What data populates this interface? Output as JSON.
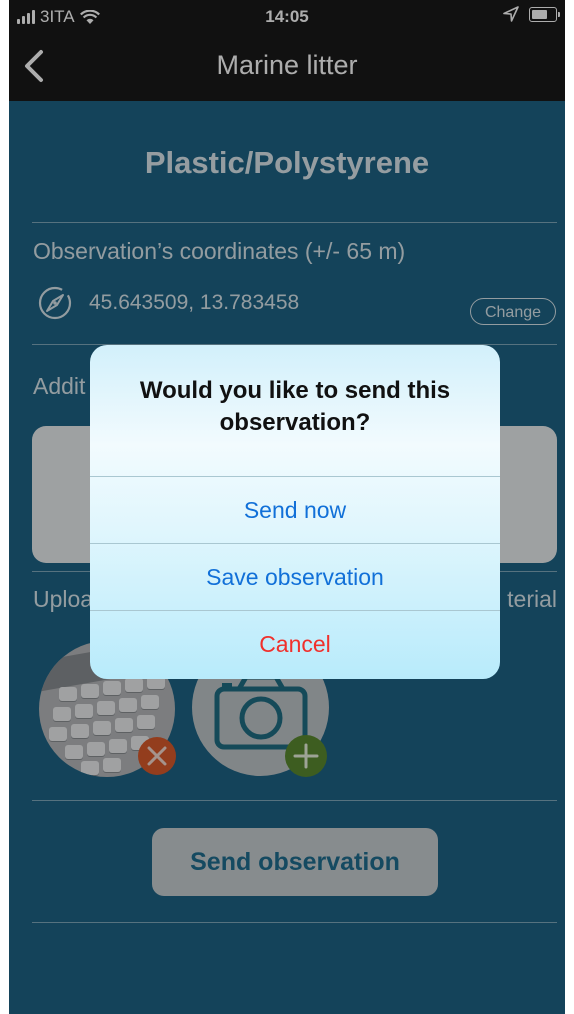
{
  "status_bar": {
    "carrier": "3ITA",
    "time": "14:05"
  },
  "nav": {
    "title": "Marine litter"
  },
  "form": {
    "category_title": "Plastic/Polystyrene",
    "coordinates_label": "Observation’s coordinates (+/- 65 m)",
    "coordinates_value": "45.643509, 13.783458",
    "change_button": "Change",
    "additional_label_partial": "Addit",
    "upload_label_partial": "Uploa",
    "material_label_partial": "terial",
    "send_button": "Send observation"
  },
  "alert": {
    "title": "Would you like to send this observation?",
    "actions": [
      {
        "label": "Send now"
      },
      {
        "label": "Save observation"
      },
      {
        "label": "Cancel"
      }
    ]
  },
  "colors": {
    "content_background": "#1e6485",
    "cancel_color": "#f0302c",
    "action_color": "#1170d8",
    "remove_badge": "#d95a2c",
    "add_badge": "#5a8a30"
  },
  "icons": [
    "back-chevron-icon",
    "signal-icon",
    "wifi-icon",
    "location-arrow-icon",
    "battery-icon",
    "compass-icon",
    "camera-icon",
    "remove-icon",
    "add-icon"
  ]
}
